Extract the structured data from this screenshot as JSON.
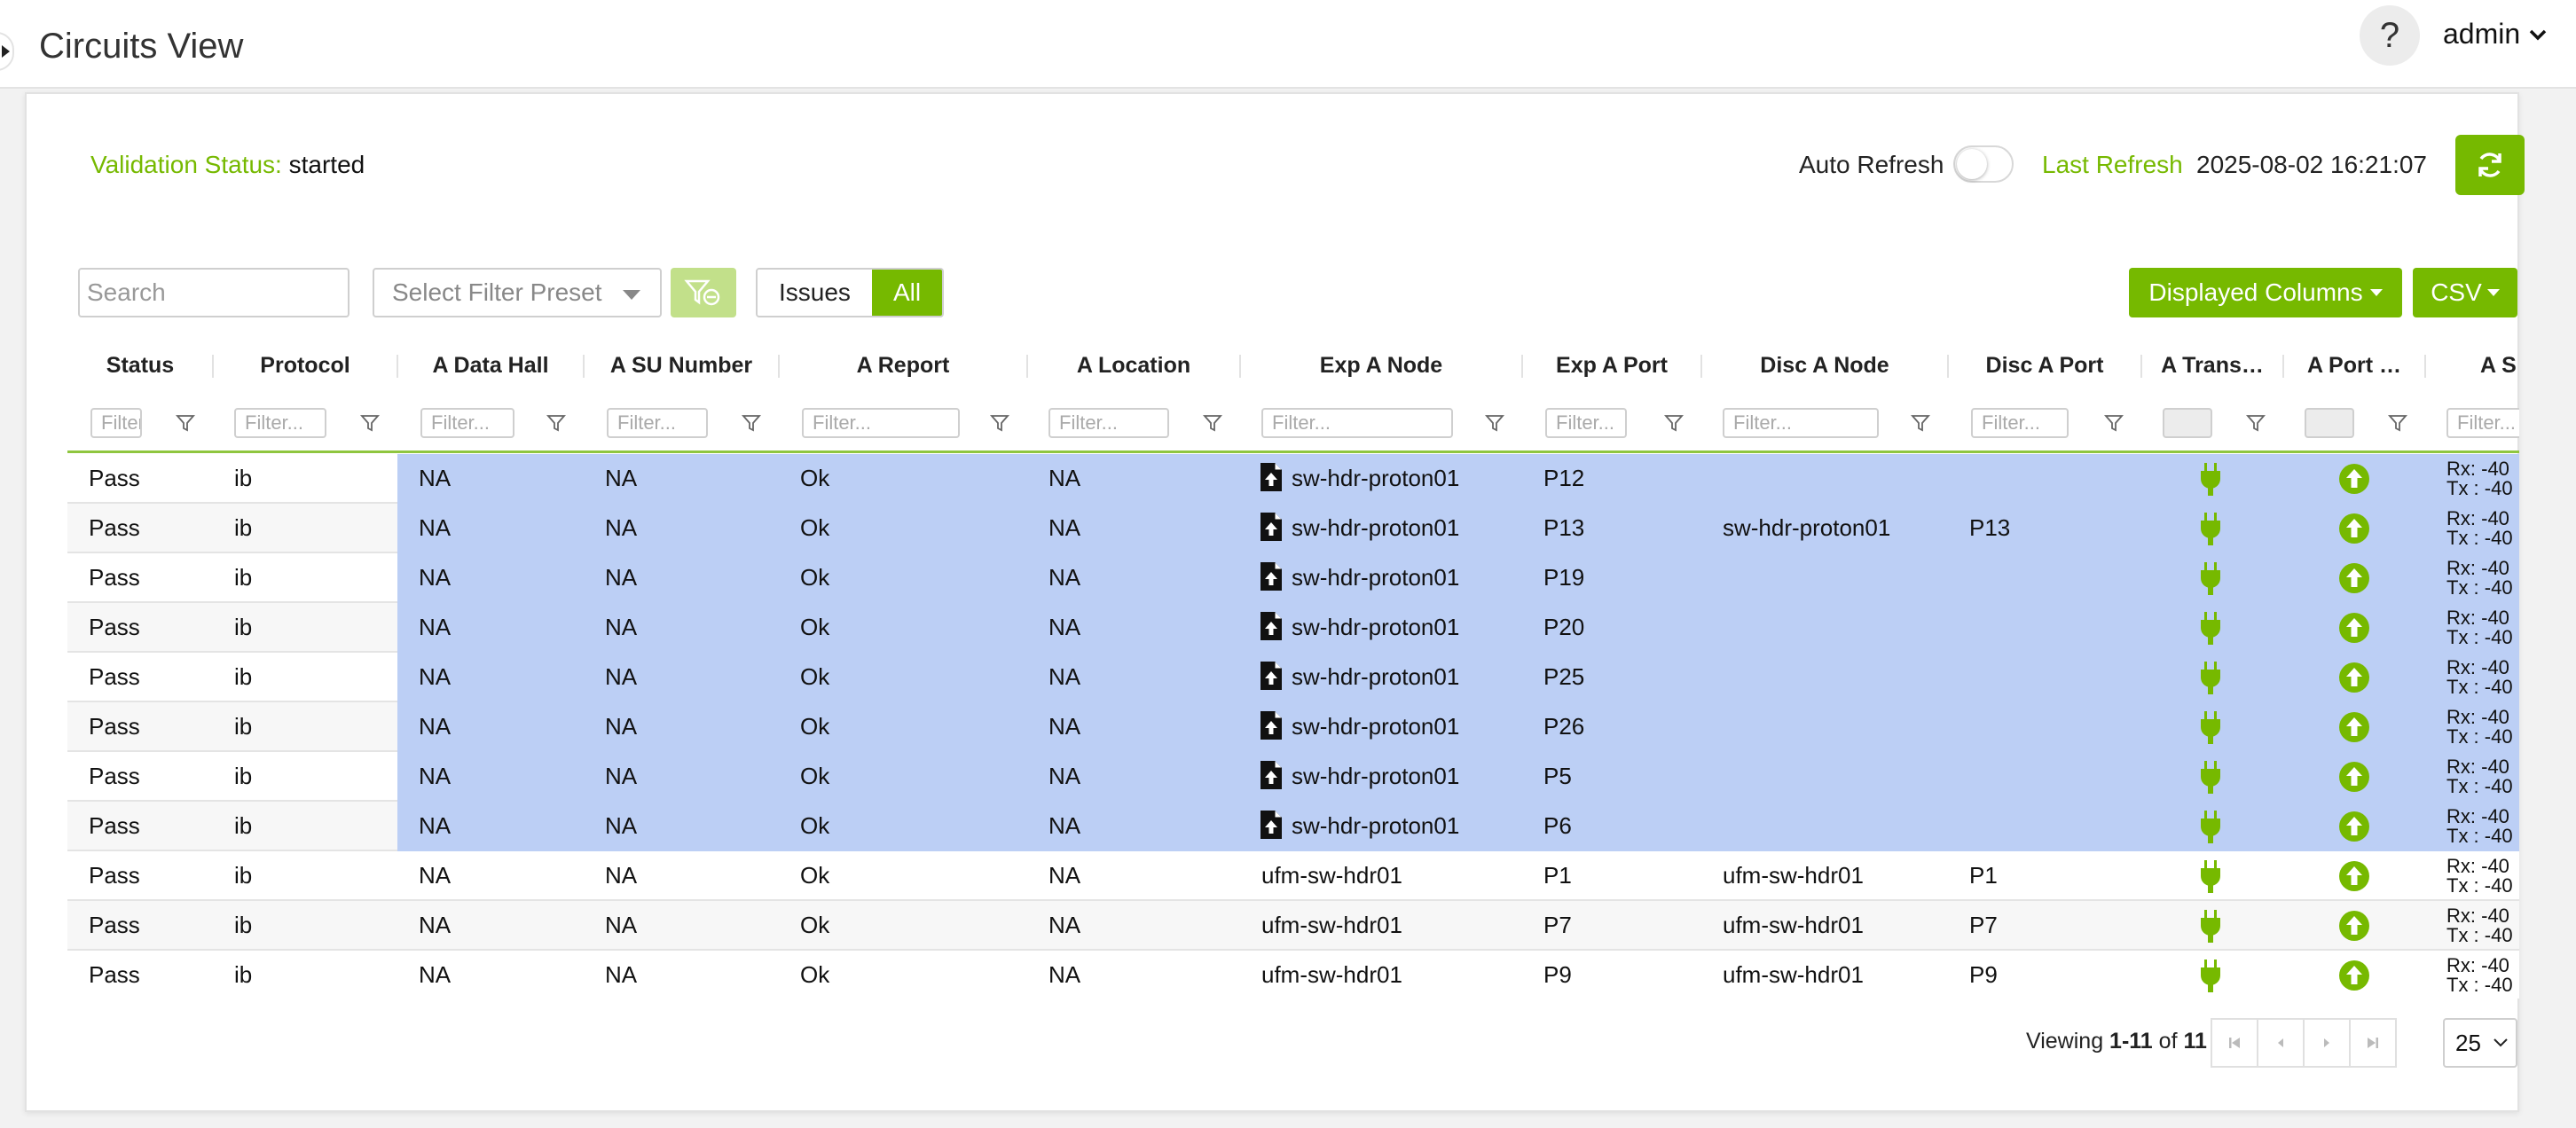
{
  "header": {
    "title": "Circuits View",
    "help_label": "?",
    "user": "admin"
  },
  "status_bar": {
    "validation_label": "Validation Status:",
    "validation_value": "started",
    "auto_refresh_label": "Auto Refresh",
    "auto_refresh_on": false,
    "last_refresh_label": "Last Refresh",
    "last_refresh_value": "2025-08-02 16:21:07"
  },
  "toolbar": {
    "search_placeholder": "Search",
    "filter_preset_placeholder": "Select Filter Preset",
    "segment_issues": "Issues",
    "segment_all": "All",
    "segment_selected": "All",
    "displayed_columns_label": "Displayed Columns",
    "csv_label": "CSV"
  },
  "columns": [
    {
      "label": "Status",
      "filter": "Filter..."
    },
    {
      "label": "Protocol",
      "filter": "Filter..."
    },
    {
      "label": "A Data Hall",
      "filter": "Filter..."
    },
    {
      "label": "A SU Number",
      "filter": "Filter..."
    },
    {
      "label": "A Report",
      "filter": "Filter..."
    },
    {
      "label": "A Location",
      "filter": "Filter..."
    },
    {
      "label": "Exp A Node",
      "filter": "Filter..."
    },
    {
      "label": "Exp A Port",
      "filter": "Filter..."
    },
    {
      "label": "Disc A Node",
      "filter": "Filter..."
    },
    {
      "label": "Disc A Port",
      "filter": "Filter..."
    },
    {
      "label": "A Trans…",
      "filter": ""
    },
    {
      "label": "A Port …",
      "filter": ""
    },
    {
      "label": "A S",
      "filter": "Filter..."
    }
  ],
  "rows": [
    {
      "status": "Pass",
      "protocol": "ib",
      "data_hall": "NA",
      "su_number": "NA",
      "report": "Ok",
      "location": "NA",
      "exp_node": "sw-hdr-proton01",
      "exp_port": "P12",
      "disc_node": "",
      "disc_port": "",
      "rx": "Rx: -40",
      "tx": "Tx : -40",
      "selected": true,
      "node_icon": true,
      "icon_style": "filled"
    },
    {
      "status": "Pass",
      "protocol": "ib",
      "data_hall": "NA",
      "su_number": "NA",
      "report": "Ok",
      "location": "NA",
      "exp_node": "sw-hdr-proton01",
      "exp_port": "P13",
      "disc_node": "sw-hdr-proton01",
      "disc_port": "P13",
      "rx": "Rx: -40",
      "tx": "Tx : -40",
      "selected": true,
      "node_icon": true,
      "icon_style": "upload"
    },
    {
      "status": "Pass",
      "protocol": "ib",
      "data_hall": "NA",
      "su_number": "NA",
      "report": "Ok",
      "location": "NA",
      "exp_node": "sw-hdr-proton01",
      "exp_port": "P19",
      "disc_node": "",
      "disc_port": "",
      "rx": "Rx: -40",
      "tx": "Tx : -40",
      "selected": true,
      "node_icon": true,
      "icon_style": "upload"
    },
    {
      "status": "Pass",
      "protocol": "ib",
      "data_hall": "NA",
      "su_number": "NA",
      "report": "Ok",
      "location": "NA",
      "exp_node": "sw-hdr-proton01",
      "exp_port": "P20",
      "disc_node": "",
      "disc_port": "",
      "rx": "Rx: -40",
      "tx": "Tx : -40",
      "selected": true,
      "node_icon": true,
      "icon_style": "upload"
    },
    {
      "status": "Pass",
      "protocol": "ib",
      "data_hall": "NA",
      "su_number": "NA",
      "report": "Ok",
      "location": "NA",
      "exp_node": "sw-hdr-proton01",
      "exp_port": "P25",
      "disc_node": "",
      "disc_port": "",
      "rx": "Rx: -40",
      "tx": "Tx : -40",
      "selected": true,
      "node_icon": true,
      "icon_style": "upload"
    },
    {
      "status": "Pass",
      "protocol": "ib",
      "data_hall": "NA",
      "su_number": "NA",
      "report": "Ok",
      "location": "NA",
      "exp_node": "sw-hdr-proton01",
      "exp_port": "P26",
      "disc_node": "",
      "disc_port": "",
      "rx": "Rx: -40",
      "tx": "Tx : -40",
      "selected": true,
      "node_icon": true,
      "icon_style": "upload"
    },
    {
      "status": "Pass",
      "protocol": "ib",
      "data_hall": "NA",
      "su_number": "NA",
      "report": "Ok",
      "location": "NA",
      "exp_node": "sw-hdr-proton01",
      "exp_port": "P5",
      "disc_node": "",
      "disc_port": "",
      "rx": "Rx: -40",
      "tx": "Tx : -40",
      "selected": true,
      "node_icon": true,
      "icon_style": "upload"
    },
    {
      "status": "Pass",
      "protocol": "ib",
      "data_hall": "NA",
      "su_number": "NA",
      "report": "Ok",
      "location": "NA",
      "exp_node": "sw-hdr-proton01",
      "exp_port": "P6",
      "disc_node": "",
      "disc_port": "",
      "rx": "Rx: -40",
      "tx": "Tx : -40",
      "selected": true,
      "node_icon": true,
      "icon_style": "upload"
    },
    {
      "status": "Pass",
      "protocol": "ib",
      "data_hall": "NA",
      "su_number": "NA",
      "report": "Ok",
      "location": "NA",
      "exp_node": "ufm-sw-hdr01",
      "exp_port": "P1",
      "disc_node": "ufm-sw-hdr01",
      "disc_port": "P1",
      "rx": "Rx: -40",
      "tx": "Tx : -40",
      "selected": false,
      "node_icon": false,
      "icon_style": ""
    },
    {
      "status": "Pass",
      "protocol": "ib",
      "data_hall": "NA",
      "su_number": "NA",
      "report": "Ok",
      "location": "NA",
      "exp_node": "ufm-sw-hdr01",
      "exp_port": "P7",
      "disc_node": "ufm-sw-hdr01",
      "disc_port": "P7",
      "rx": "Rx: -40",
      "tx": "Tx : -40",
      "selected": false,
      "node_icon": false,
      "icon_style": ""
    },
    {
      "status": "Pass",
      "protocol": "ib",
      "data_hall": "NA",
      "su_number": "NA",
      "report": "Ok",
      "location": "NA",
      "exp_node": "ufm-sw-hdr01",
      "exp_port": "P9",
      "disc_node": "ufm-sw-hdr01",
      "disc_port": "P9",
      "rx": "Rx: -40",
      "tx": "Tx : -40",
      "selected": false,
      "node_icon": false,
      "icon_style": ""
    }
  ],
  "footer": {
    "viewing_prefix": "Viewing ",
    "viewing_range": "1-11",
    "viewing_of": " of ",
    "viewing_total": "11",
    "page_size": "25"
  },
  "colors": {
    "accent": "#76b900",
    "selected_row": "#bccff5",
    "transceiver_icon": "#76b900",
    "port_up_icon": "#76b900"
  },
  "icons": {
    "transceiver": "plug-icon",
    "port_state": "arrow-up-circle-icon",
    "exp_node": "file-upload-icon",
    "refresh": "refresh-icon",
    "filter": "filter-icon"
  }
}
